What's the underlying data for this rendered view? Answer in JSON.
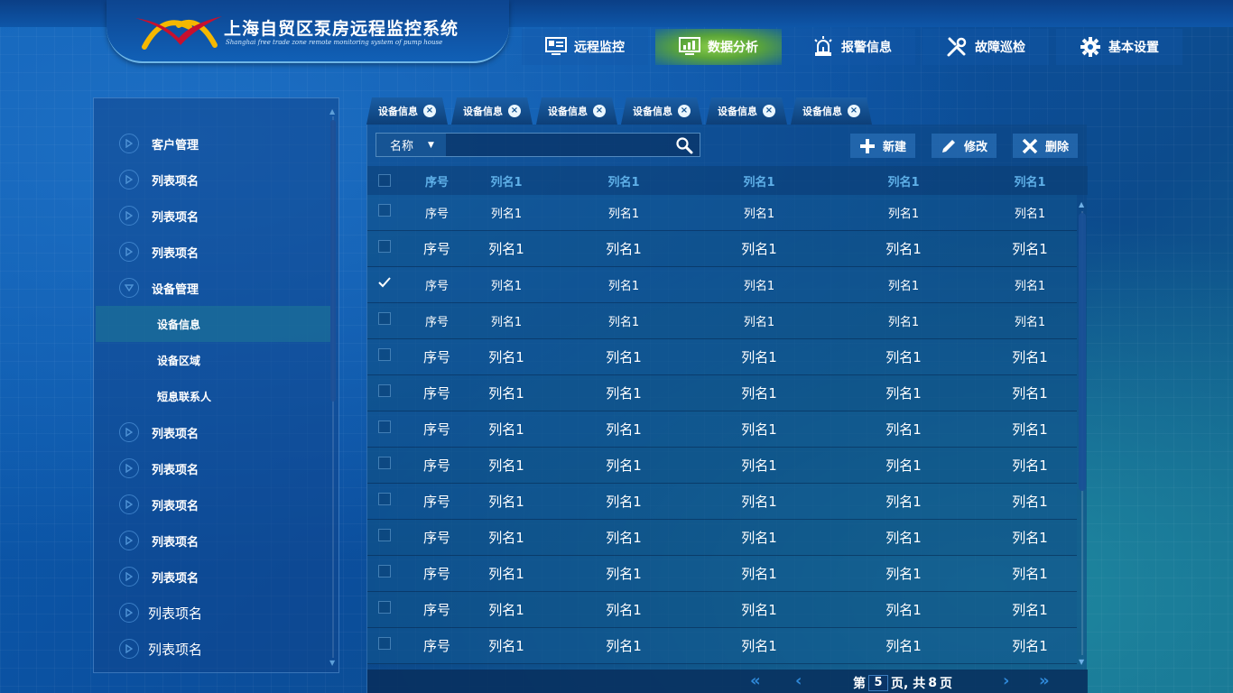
{
  "header": {
    "title": "上海自贸区泵房远程监控系统",
    "subtitle": "Shanghai free trade zone remote monitoring system of pump house",
    "nav": [
      {
        "label": "远程监控",
        "icon": "monitor-icon",
        "active": false
      },
      {
        "label": "数据分析",
        "icon": "bar-chart-icon",
        "active": true
      },
      {
        "label": "报警信息",
        "icon": "alarm-light-icon",
        "active": false
      },
      {
        "label": "故障巡检",
        "icon": "tools-icon",
        "active": false
      },
      {
        "label": "基本设置",
        "icon": "gear-icon",
        "active": false
      }
    ]
  },
  "sidebar": {
    "items": [
      {
        "label": "客户管理",
        "type": "group",
        "icon": "play-circle-icon"
      },
      {
        "label": "列表项名",
        "type": "group",
        "icon": "play-circle-icon"
      },
      {
        "label": "列表项名",
        "type": "group",
        "icon": "play-circle-icon"
      },
      {
        "label": "列表项名",
        "type": "group",
        "icon": "play-circle-icon"
      },
      {
        "label": "设备管理",
        "type": "group-open",
        "icon": "expand-circle-icon"
      },
      {
        "label": "设备信息",
        "type": "sub",
        "active": true
      },
      {
        "label": "设备区域",
        "type": "sub"
      },
      {
        "label": "短息联系人",
        "type": "sub"
      },
      {
        "label": "列表项名",
        "type": "group",
        "icon": "play-circle-icon"
      },
      {
        "label": "列表项名",
        "type": "group",
        "icon": "play-circle-icon"
      },
      {
        "label": "列表项名",
        "type": "group",
        "icon": "play-circle-icon"
      },
      {
        "label": "列表项名",
        "type": "group",
        "icon": "play-circle-icon"
      },
      {
        "label": "列表项名",
        "type": "group",
        "icon": "play-circle-icon"
      },
      {
        "label": "列表项名",
        "type": "group-big",
        "icon": "play-circle-icon"
      },
      {
        "label": "列表项名",
        "type": "group-big",
        "icon": "play-circle-icon"
      }
    ]
  },
  "tabs": [
    "设备信息",
    "设备信息",
    "设备信息",
    "设备信息",
    "设备信息",
    "设备信息"
  ],
  "toolbar": {
    "search_select_value": "名称",
    "search_placeholder": "",
    "new_label": "新建",
    "edit_label": "修改",
    "delete_label": "删除"
  },
  "table": {
    "columns": [
      "序号",
      "列名1",
      "列名1",
      "列名1",
      "列名1",
      "列名1"
    ],
    "rows": [
      {
        "small": true,
        "checked": false,
        "cells": [
          "序号",
          "列名1",
          "列名1",
          "列名1",
          "列名1",
          "列名1"
        ]
      },
      {
        "small": false,
        "checked": false,
        "cells": [
          "序号",
          "列名1",
          "列名1",
          "列名1",
          "列名1",
          "列名1"
        ]
      },
      {
        "small": true,
        "checked": true,
        "cells": [
          "序号",
          "列名1",
          "列名1",
          "列名1",
          "列名1",
          "列名1"
        ]
      },
      {
        "small": true,
        "checked": false,
        "cells": [
          "序号",
          "列名1",
          "列名1",
          "列名1",
          "列名1",
          "列名1"
        ]
      },
      {
        "small": false,
        "checked": false,
        "cells": [
          "序号",
          "列名1",
          "列名1",
          "列名1",
          "列名1",
          "列名1"
        ]
      },
      {
        "small": false,
        "checked": false,
        "cells": [
          "序号",
          "列名1",
          "列名1",
          "列名1",
          "列名1",
          "列名1"
        ]
      },
      {
        "small": false,
        "checked": false,
        "cells": [
          "序号",
          "列名1",
          "列名1",
          "列名1",
          "列名1",
          "列名1"
        ]
      },
      {
        "small": false,
        "checked": false,
        "cells": [
          "序号",
          "列名1",
          "列名1",
          "列名1",
          "列名1",
          "列名1"
        ]
      },
      {
        "small": false,
        "checked": false,
        "cells": [
          "序号",
          "列名1",
          "列名1",
          "列名1",
          "列名1",
          "列名1"
        ]
      },
      {
        "small": false,
        "checked": false,
        "cells": [
          "序号",
          "列名1",
          "列名1",
          "列名1",
          "列名1",
          "列名1"
        ]
      },
      {
        "small": false,
        "checked": false,
        "cells": [
          "序号",
          "列名1",
          "列名1",
          "列名1",
          "列名1",
          "列名1"
        ]
      },
      {
        "small": false,
        "checked": false,
        "cells": [
          "序号",
          "列名1",
          "列名1",
          "列名1",
          "列名1",
          "列名1"
        ]
      },
      {
        "small": false,
        "checked": false,
        "cells": [
          "序号",
          "列名1",
          "列名1",
          "列名1",
          "列名1",
          "列名1"
        ]
      }
    ]
  },
  "pager": {
    "prefix": "第",
    "current": "5",
    "middle": "页, 共",
    "total": "8",
    "suffix": "页"
  },
  "colors": {
    "accent_green": "#8fd14b",
    "header_text": "#5fb0e8",
    "logo_red": "#c8102e",
    "logo_yellow": "#f5b800"
  }
}
